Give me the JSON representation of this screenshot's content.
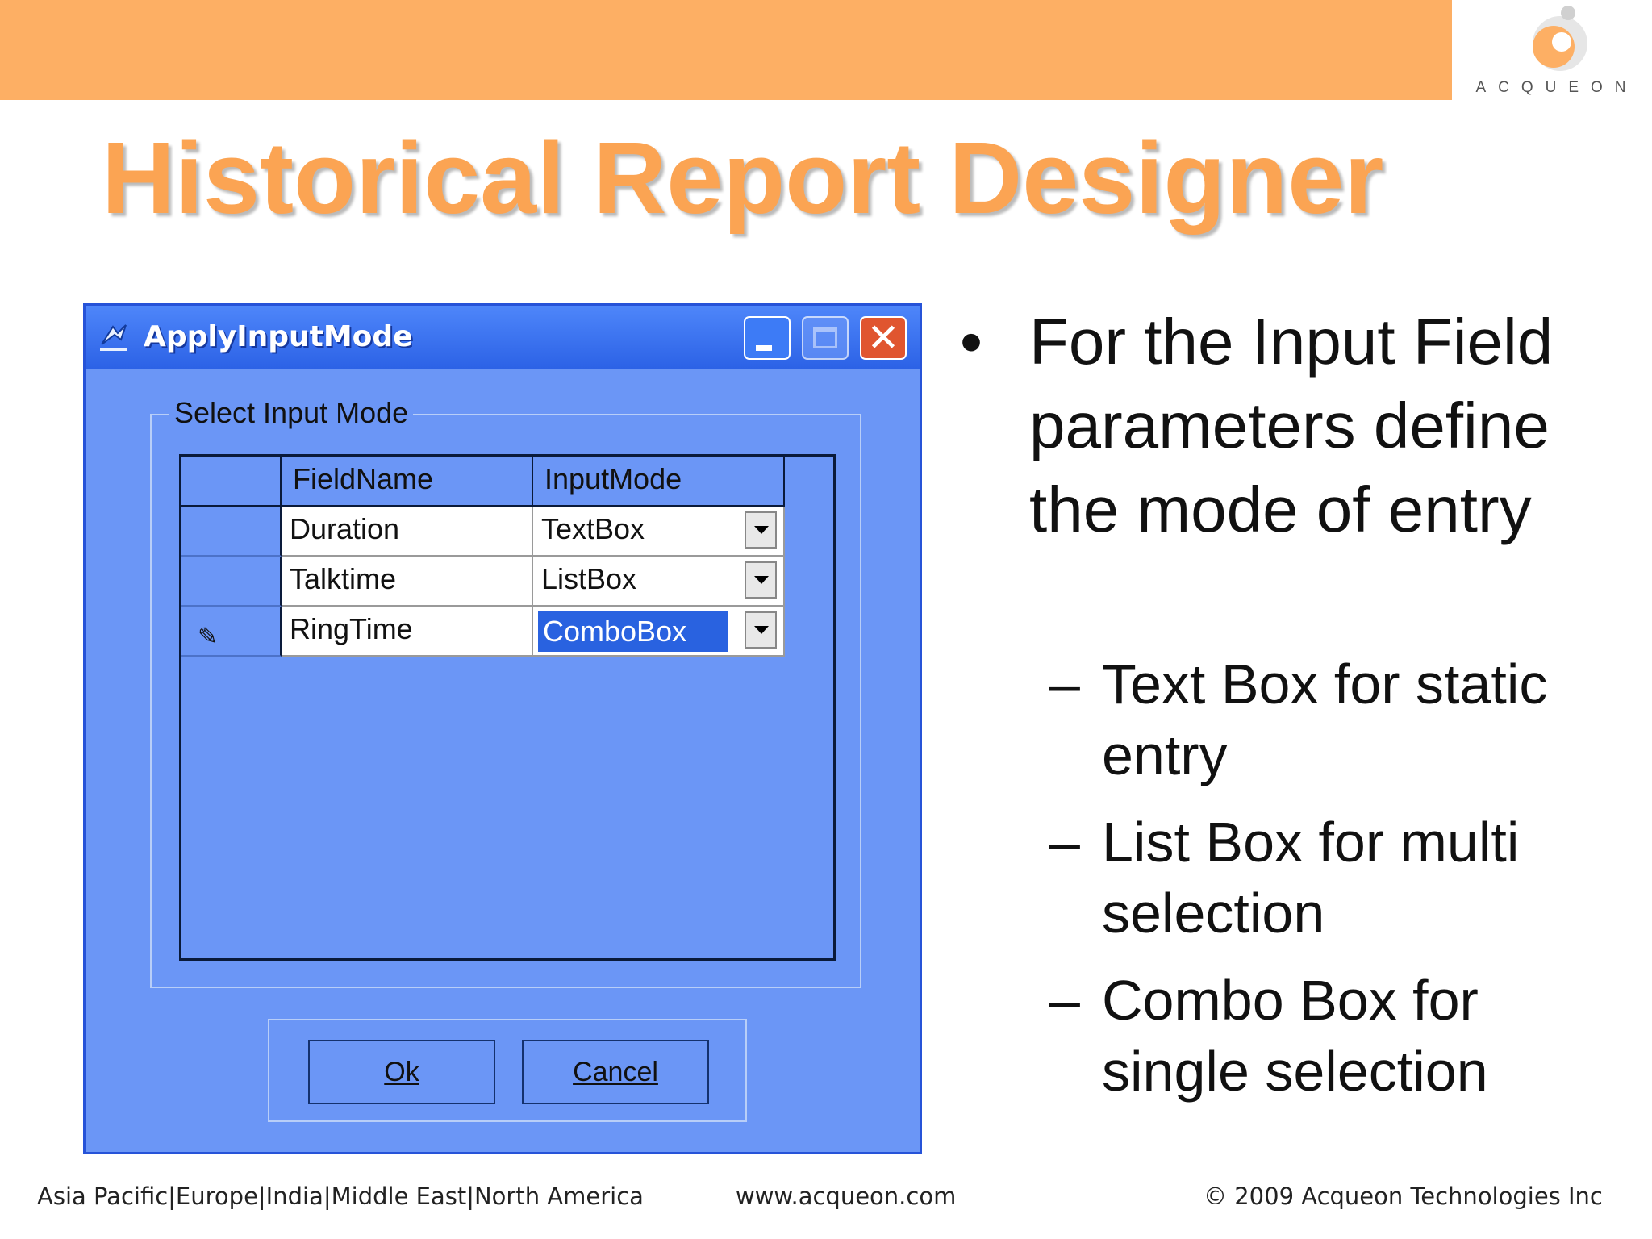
{
  "slide": {
    "title": "Historical Report Designer",
    "brand": "ACQUEON",
    "accent_color": "#FDAF64",
    "title_color": "#FBA453"
  },
  "dialog": {
    "title": "ApplyInputMode",
    "group_label": "Select Input Mode",
    "columns": [
      "FieldName",
      "InputMode"
    ],
    "rows": [
      {
        "field": "Duration",
        "mode": "TextBox",
        "editing": false
      },
      {
        "field": "Talktime",
        "mode": "ListBox",
        "editing": false
      },
      {
        "field": "RingTime",
        "mode": "ComboBox",
        "editing": true
      }
    ],
    "ok_label": "Ok",
    "cancel_label": "Cancel",
    "window_color": "#6B96F6"
  },
  "bullets": {
    "main": "For the Input Field parameters define the mode of entry",
    "subs": [
      "Text Box for static entry",
      "List Box for multi selection",
      "Combo Box for single selection"
    ]
  },
  "footer": {
    "regions": "Asia Pacific|Europe|India|Middle East|North America",
    "url": "www.acqueon.com",
    "copyright": "© 2009 Acqueon Technologies Inc"
  }
}
